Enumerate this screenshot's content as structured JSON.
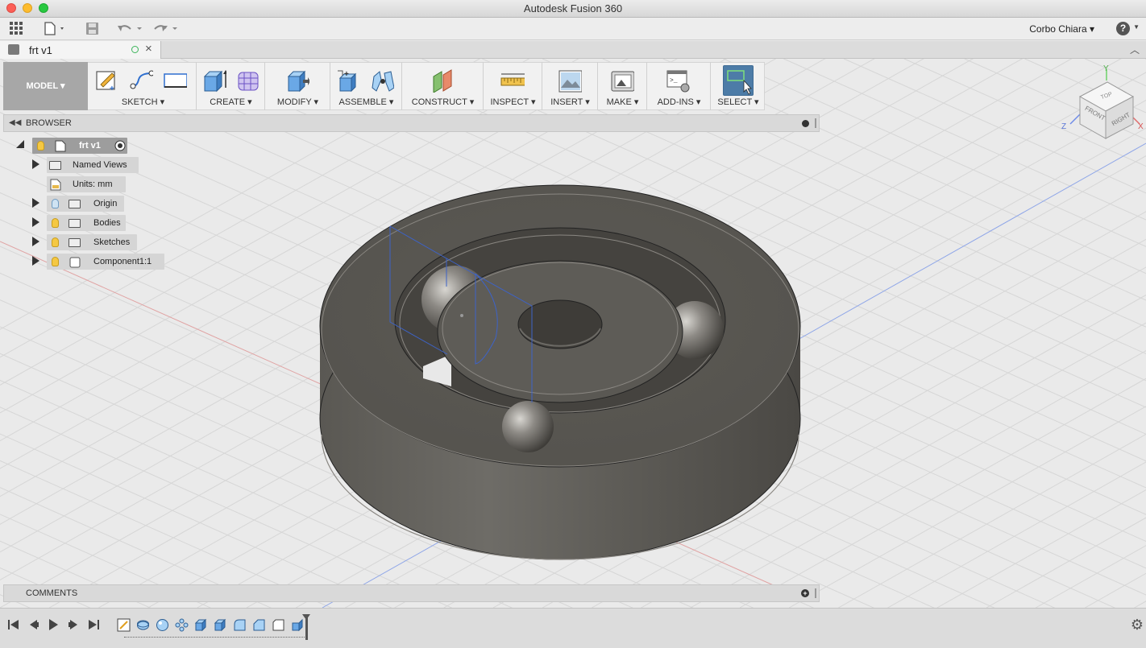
{
  "window": {
    "title": "Autodesk Fusion 360"
  },
  "quick_access": {
    "user_name": "Corbo Chiara",
    "icons": [
      "app-grid-icon",
      "file-icon",
      "save-icon",
      "undo-icon",
      "redo-icon",
      "help-icon"
    ]
  },
  "document_tab": {
    "label": "frt v1"
  },
  "toolbar": {
    "workspace": "MODEL",
    "groups": [
      {
        "label": "SKETCH"
      },
      {
        "label": "CREATE"
      },
      {
        "label": "MODIFY"
      },
      {
        "label": "ASSEMBLE"
      },
      {
        "label": "CONSTRUCT"
      },
      {
        "label": "INSPECT"
      },
      {
        "label": "INSERT"
      },
      {
        "label": "MAKE"
      },
      {
        "label": "ADD-INS"
      },
      {
        "label": "SELECT"
      }
    ]
  },
  "browser": {
    "title": "BROWSER",
    "root": "frt v1",
    "items": [
      {
        "label": "Named Views"
      },
      {
        "label": "Units: mm"
      },
      {
        "label": "Origin"
      },
      {
        "label": "Bodies"
      },
      {
        "label": "Sketches"
      },
      {
        "label": "Component1:1"
      }
    ]
  },
  "viewcube": {
    "top": "TOP",
    "front": "FRONT",
    "right": "RIGHT",
    "axis_x": "X",
    "axis_y": "Y",
    "axis_z": "Z"
  },
  "comments": {
    "title": "COMMENTS"
  },
  "colors": {
    "accent": "#4d7ca7",
    "body": "#5e5b56",
    "grid": "#d6d6d6"
  }
}
